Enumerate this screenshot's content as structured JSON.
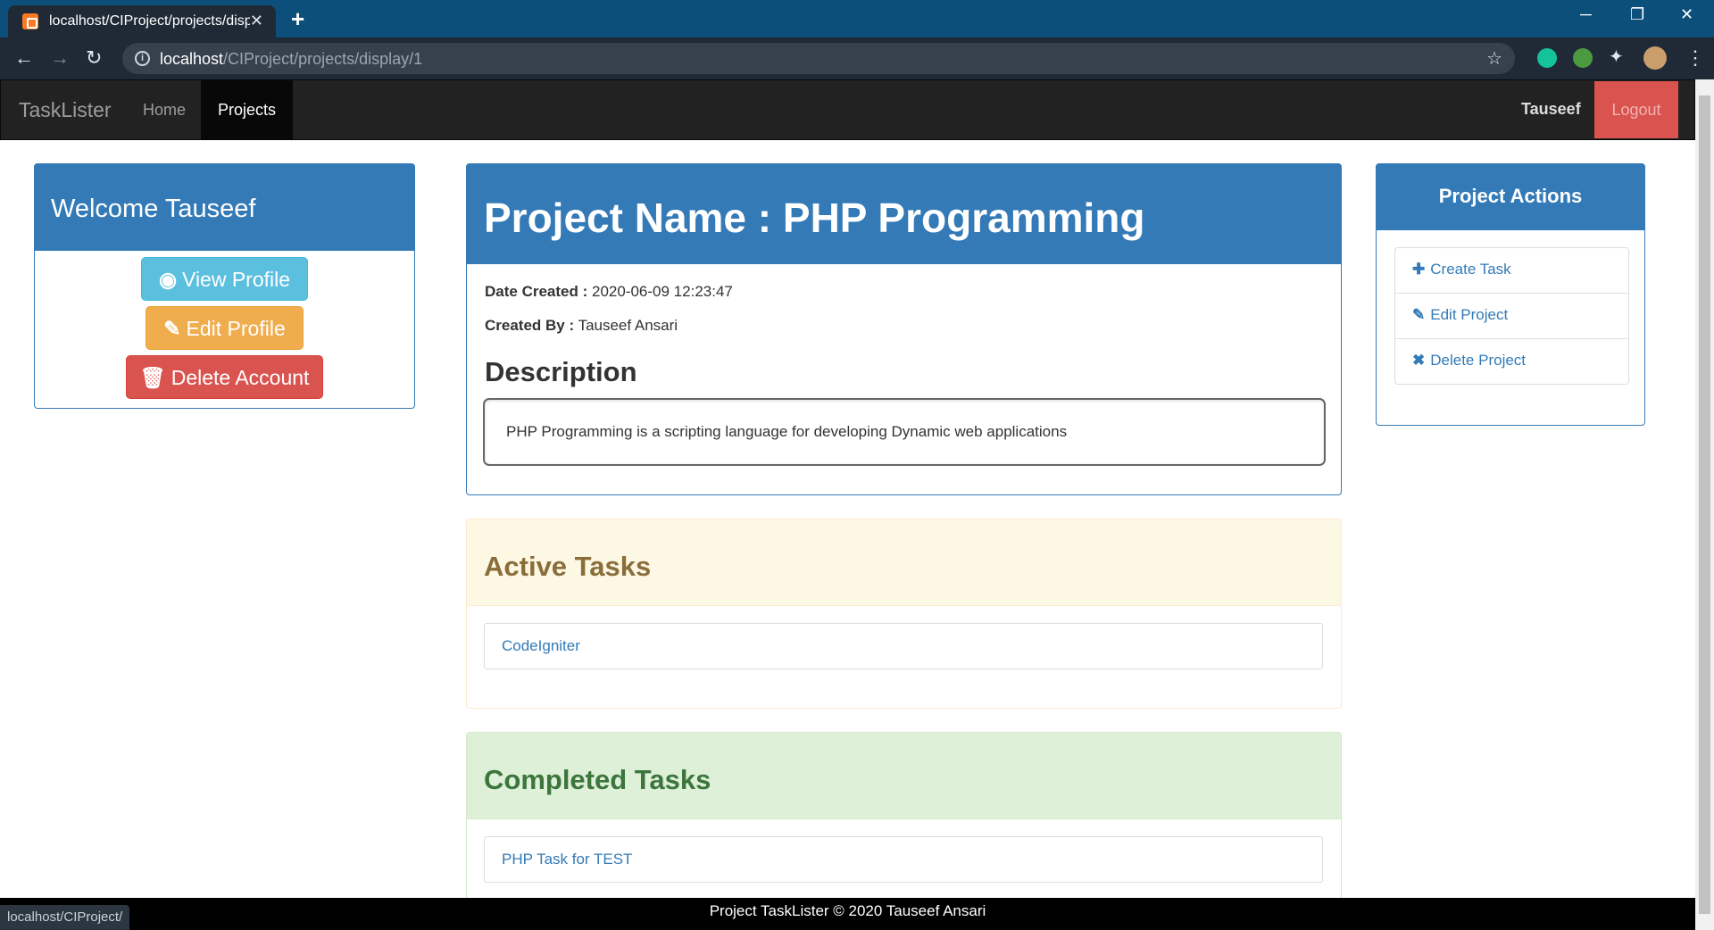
{
  "browser": {
    "tab_title": "localhost/CIProject/projects/display/1",
    "url_host": "localhost",
    "url_path": "/CIProject/projects/display/1",
    "status_url": "localhost/CIProject/"
  },
  "navbar": {
    "brand": "TaskLister",
    "links": [
      {
        "label": "Home",
        "active": false
      },
      {
        "label": "Projects",
        "active": true
      }
    ],
    "user": "Tauseef",
    "logout": "Logout"
  },
  "sidebar": {
    "welcome": "Welcome Tauseef",
    "buttons": {
      "view_profile": "View Profile",
      "edit_profile": "Edit Profile",
      "delete_account": "Delete Account"
    }
  },
  "project": {
    "title": "Project Name : PHP Programming",
    "date_label": "Date Created :",
    "date_value": "2020-06-09 12:23:47",
    "created_by_label": "Created By :",
    "created_by_value": "Tauseef Ansari",
    "description_heading": "Description",
    "description": "PHP Programming is a scripting language for developing Dynamic web applications"
  },
  "active_tasks": {
    "heading": "Active Tasks",
    "items": [
      "CodeIgniter"
    ]
  },
  "completed_tasks": {
    "heading": "Completed Tasks",
    "items": [
      "PHP Task for TEST"
    ]
  },
  "actions": {
    "heading": "Project Actions",
    "items": [
      {
        "label": "Create Task",
        "icon": "plus-icon"
      },
      {
        "label": "Edit Project",
        "icon": "edit-icon"
      },
      {
        "label": "Delete Project",
        "icon": "remove-icon"
      }
    ]
  },
  "footer": {
    "text": "Project TaskLister © 2020 Tauseef Ansari"
  },
  "colors": {
    "primary": "#337ab7",
    "info": "#5bc0de",
    "warning": "#f0ad4e",
    "danger": "#d9534f",
    "active_panel_bg": "#fcf8e3",
    "completed_panel_bg": "#dff0d8"
  }
}
